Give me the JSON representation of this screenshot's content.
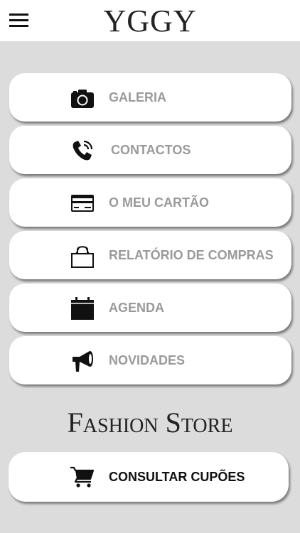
{
  "header": {
    "logo_text": "YGGY",
    "menu_icon": "hamburger-icon"
  },
  "menu": {
    "items": [
      {
        "label": "GALERIA",
        "icon": "camera-icon"
      },
      {
        "label": "CONTACTOS",
        "icon": "phone-icon"
      },
      {
        "label": "O MEU CARTÃO",
        "icon": "credit-card-icon"
      },
      {
        "label": "RELATÓRIO DE COMPRAS",
        "icon": "shopping-bag-icon"
      },
      {
        "label": "AGENDA",
        "icon": "calendar-icon"
      },
      {
        "label": "NOVIDADES",
        "icon": "megaphone-icon"
      }
    ]
  },
  "brand": {
    "name": "Fashion Store"
  },
  "coupons": {
    "label": "CONSULTAR CUPÕES",
    "icon": "cart-icon"
  },
  "colors": {
    "background": "#dcdcdc",
    "card": "#ffffff",
    "label_muted": "#9a9a9a",
    "label_dark": "#111111"
  }
}
